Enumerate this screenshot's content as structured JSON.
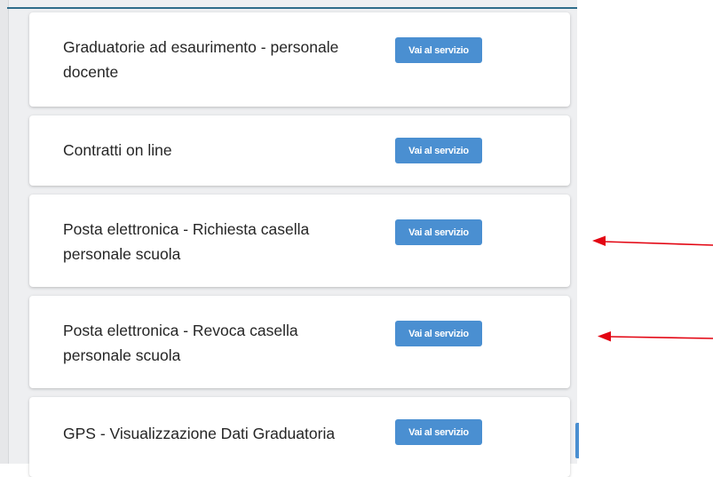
{
  "colors": {
    "button_bg": "#4a8fd1",
    "button_text": "#ffffff",
    "arrow": "#e30613",
    "background": "#eeeff1",
    "card": "#ffffff"
  },
  "services": [
    {
      "title": "Graduatorie ad esaurimento - personale docente",
      "button_label": "Vai al servizio"
    },
    {
      "title": "Contratti on line",
      "button_label": "Vai al servizio"
    },
    {
      "title": "Posta elettronica - Richiesta casella personale scuola",
      "button_label": "Vai al servizio"
    },
    {
      "title": "Posta elettronica - Revoca casella personale scuola",
      "button_label": "Vai al servizio"
    },
    {
      "title": "GPS - Visualizzazione Dati Graduatoria",
      "button_label": "Vai al servizio"
    }
  ],
  "annotations": {
    "arrow_icons": [
      "left-arrow-icon",
      "left-arrow-icon"
    ]
  }
}
